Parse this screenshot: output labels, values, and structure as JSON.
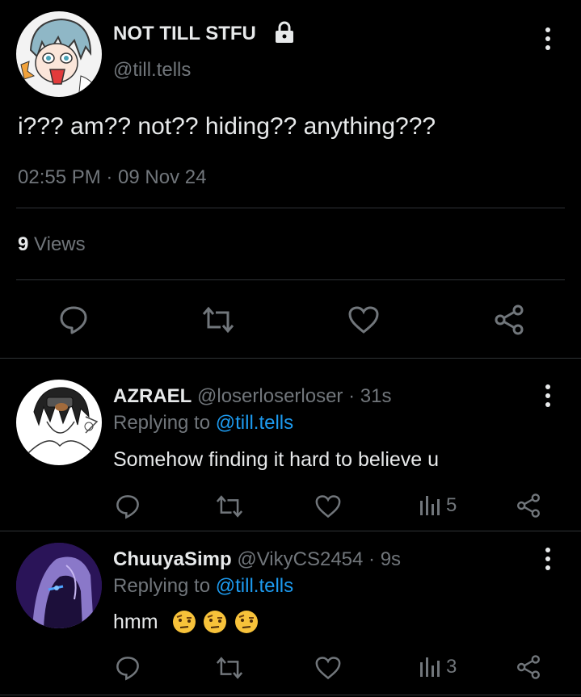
{
  "main_tweet": {
    "display_name": "NOT TILL STFU",
    "handle": "@till.tells",
    "text": "i??? am?? not?? hiding?? anything???",
    "timestamp": "02:55 PM · 09 Nov 24",
    "views_count": "9",
    "views_label": "Views",
    "locked_icon": "lock-icon"
  },
  "replies": [
    {
      "display_name": "AZRAEL",
      "handle": "@loserloserloser",
      "time": "· 31s",
      "replying_prefix": "Replying to",
      "replying_to": "@till.tells",
      "text": "Somehow finding it hard to believe u",
      "views": "5"
    },
    {
      "display_name": "ChuuyaSimp",
      "handle": "@VikyCS2454",
      "time": "· 9s",
      "replying_prefix": "Replying to",
      "replying_to": "@till.tells",
      "text": "hmm",
      "views": "3",
      "emoji": [
        "raised-eyebrow-emoji",
        "raised-eyebrow-emoji",
        "raised-eyebrow-emoji"
      ]
    }
  ],
  "colors": {
    "background": "#000000",
    "text": "#e7e9ea",
    "muted": "#71767b",
    "link": "#1d9bf0",
    "divider": "#2f3336"
  }
}
